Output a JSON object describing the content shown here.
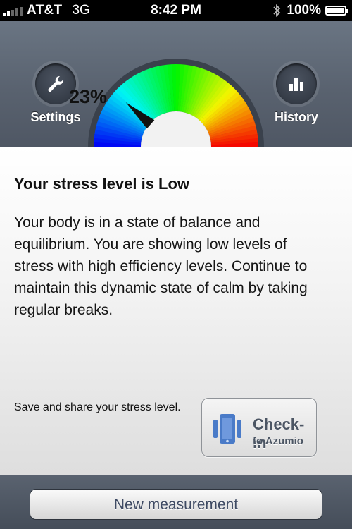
{
  "status_bar": {
    "carrier": "AT&T",
    "network": "3G",
    "time": "8:42 PM",
    "battery": "100%"
  },
  "header": {
    "settings_label": "Settings",
    "history_label": "History",
    "gauge_value": "23%",
    "gauge_level": 0.23
  },
  "content": {
    "title": "Your stress level is Low",
    "body": "Your body is in a state of balance and equilibrium. You are showing low levels of stress with high efficiency levels. Continue to maintain this dynamic state of calm by taking regular breaks.",
    "share_text": "Save and share your stress level.",
    "checkin_title": "Check-in",
    "checkin_subtitle": "to Azumio"
  },
  "footer": {
    "new_measurement_label": "New measurement"
  },
  "colors": {
    "header_bg": "#59626f",
    "button_text": "#4c5664"
  },
  "icons": {
    "settings": "wrench-icon",
    "history": "bar-chart-icon",
    "checkin": "phone-device-icon",
    "bluetooth": "bluetooth-icon"
  }
}
